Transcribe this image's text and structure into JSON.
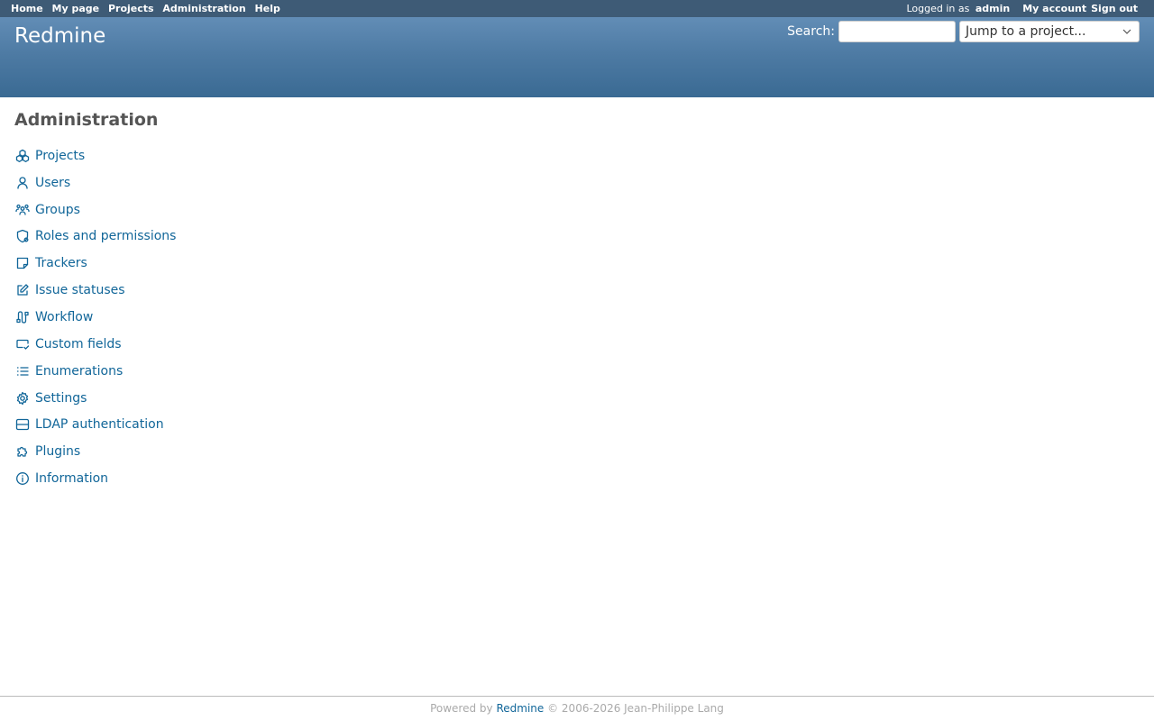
{
  "top_menu": {
    "left": [
      "Home",
      "My page",
      "Projects",
      "Administration",
      "Help"
    ],
    "logged_in_prefix": "Logged in as",
    "user": "admin",
    "my_account": "My account",
    "sign_out": "Sign out"
  },
  "header": {
    "title": "Redmine",
    "search_label": "Search:",
    "search_value": "",
    "jump_placeholder": "Jump to a project..."
  },
  "content": {
    "title": "Administration",
    "items": [
      {
        "label": "Projects",
        "icon": "projects-icon"
      },
      {
        "label": "Users",
        "icon": "user-icon"
      },
      {
        "label": "Groups",
        "icon": "group-icon"
      },
      {
        "label": "Roles and permissions",
        "icon": "shield-icon"
      },
      {
        "label": "Trackers",
        "icon": "note-icon"
      },
      {
        "label": "Issue statuses",
        "icon": "edit-icon"
      },
      {
        "label": "Workflow",
        "icon": "workflow-icon"
      },
      {
        "label": "Custom fields",
        "icon": "custom-field-icon"
      },
      {
        "label": "Enumerations",
        "icon": "list-icon"
      },
      {
        "label": "Settings",
        "icon": "gear-icon"
      },
      {
        "label": "LDAP authentication",
        "icon": "server-icon"
      },
      {
        "label": "Plugins",
        "icon": "puzzle-icon"
      },
      {
        "label": "Information",
        "icon": "info-icon"
      }
    ]
  },
  "footer": {
    "prefix": "Powered by",
    "link": "Redmine",
    "suffix": "© 2006-2026 Jean-Philippe Lang"
  },
  "colors": {
    "top_menu_bg": "#3e5b76",
    "header_bg": "#628db6",
    "link": "#169"
  }
}
